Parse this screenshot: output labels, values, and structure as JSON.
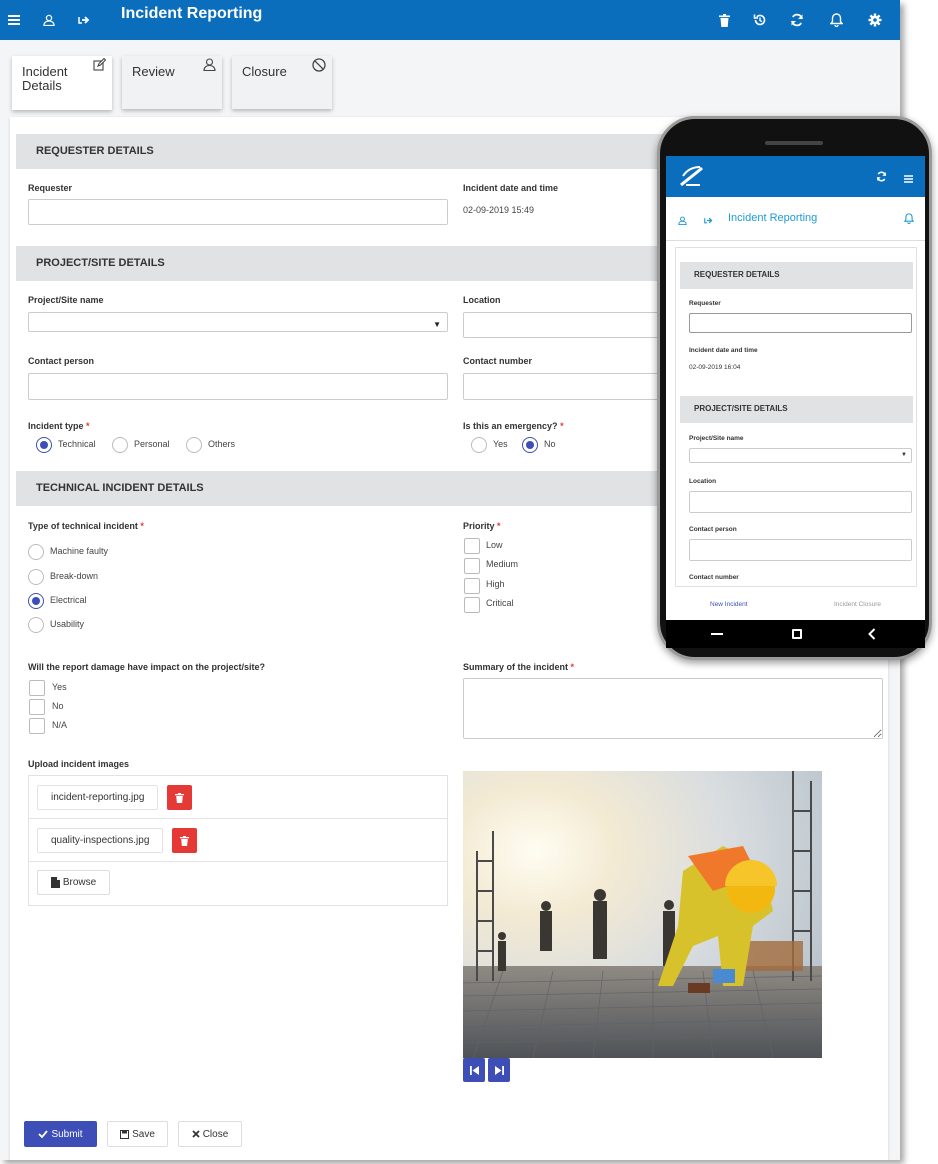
{
  "app": {
    "title": "Incident Reporting",
    "brand_color": "#0a6ebd",
    "accent_color": "#3d4fb6",
    "danger_color": "#e53935"
  },
  "topbar": {
    "left_icons": [
      "menu-icon",
      "user-icon",
      "logout-icon"
    ],
    "right_icons": [
      "trash-icon",
      "history-icon",
      "refresh-icon",
      "bell-icon",
      "gear-icon"
    ]
  },
  "tabs": [
    {
      "label": "Incident Details",
      "icon": "edit-icon",
      "active": true
    },
    {
      "label": "Review",
      "icon": "user-review-icon",
      "active": false
    },
    {
      "label": "Closure",
      "icon": "ban-icon",
      "active": false
    }
  ],
  "sections": {
    "requester": "REQUESTER DETAILS",
    "project": "PROJECT/SITE DETAILS",
    "technical": "TECHNICAL INCIDENT DETAILS"
  },
  "fields": {
    "requester_label": "Requester",
    "requester_value": "",
    "datetime_label": "Incident date and time",
    "datetime_value": "02-09-2019 15:49",
    "project_label": "Project/Site name",
    "location_label": "Location",
    "contact_person_label": "Contact person",
    "contact_number_label": "Contact number",
    "incident_type_label": "Incident type",
    "incident_type_options": [
      "Technical",
      "Personal",
      "Others"
    ],
    "incident_type_selected": "Technical",
    "emergency_label": "Is this an emergency?",
    "emergency_options": [
      "Yes",
      "No"
    ],
    "emergency_selected": "No",
    "tech_type_label": "Type of technical incident",
    "tech_type_options": [
      "Machine faulty",
      "Break-down",
      "Electrical",
      "Usability"
    ],
    "tech_type_selected": "Electrical",
    "priority_label": "Priority",
    "priority_options": [
      "Low",
      "Medium",
      "High",
      "Critical"
    ],
    "impact_label": "Will the report damage have impact on the project/site?",
    "impact_options": [
      "Yes",
      "No",
      "N/A"
    ],
    "summary_label": "Summary of the incident",
    "required_mark": "*",
    "upload_label": "Upload incident images"
  },
  "uploads": [
    {
      "file": "incident-reporting.jpg"
    },
    {
      "file": "quality-inspections.jpg"
    }
  ],
  "buttons": {
    "browse": "Browse",
    "submit": "Submit",
    "save": "Save",
    "close": "Close"
  },
  "mobile": {
    "title": "Incident Reporting",
    "sections": [
      "REQUESTER DETAILS",
      "PROJECT/SITE DETAILS"
    ],
    "requester_label": "Requester",
    "datetime_label": "Incident date and time",
    "datetime_value": "02-09-2019 16:04",
    "project_label": "Project/Site name",
    "location_label": "Location",
    "contact_person_label": "Contact person",
    "contact_number_label": "Contact number",
    "footer_left": "New Incident",
    "footer_right": "Incident Closure"
  }
}
